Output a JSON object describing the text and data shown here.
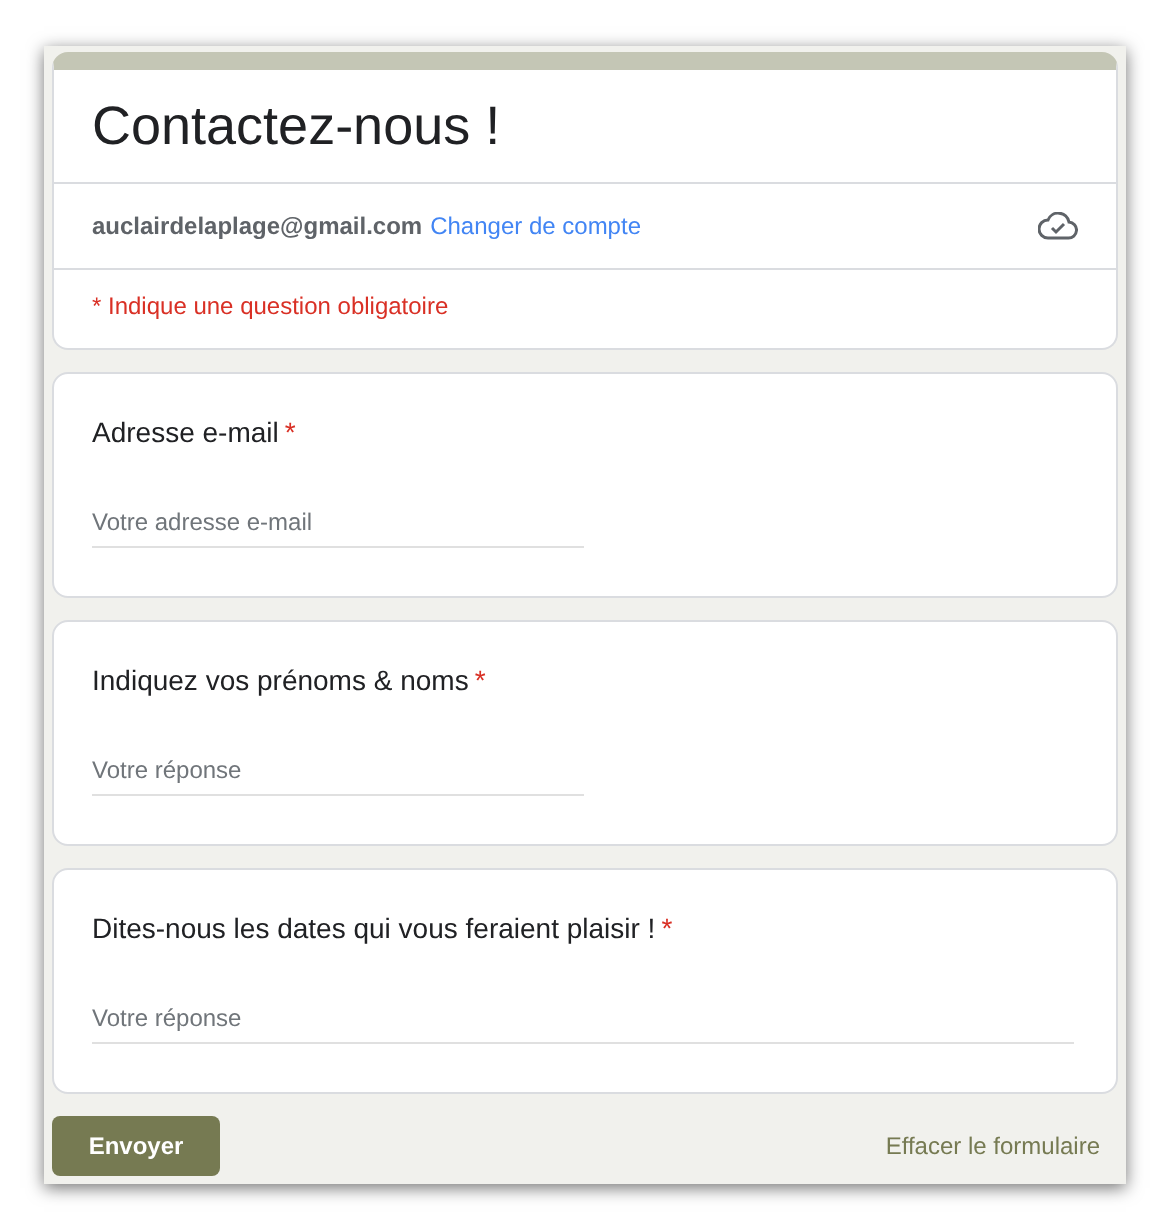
{
  "form": {
    "title": "Contactez-nous !",
    "account_email": "auclairdelaplage@gmail.com",
    "switch_account": "Changer de compte",
    "required_note": "* Indique une question obligatoire"
  },
  "questions": [
    {
      "label": "Adresse e-mail",
      "required_mark": "*",
      "placeholder": "Votre adresse e-mail",
      "kind": "short"
    },
    {
      "label": "Indiquez vos prénoms & noms",
      "required_mark": "*",
      "placeholder": "Votre réponse",
      "kind": "short"
    },
    {
      "label": "Dites-nous les dates qui vous feraient plaisir !",
      "required_mark": "*",
      "placeholder": "Votre réponse",
      "kind": "long"
    }
  ],
  "actions": {
    "submit": "Envoyer",
    "clear": "Effacer le formulaire"
  }
}
